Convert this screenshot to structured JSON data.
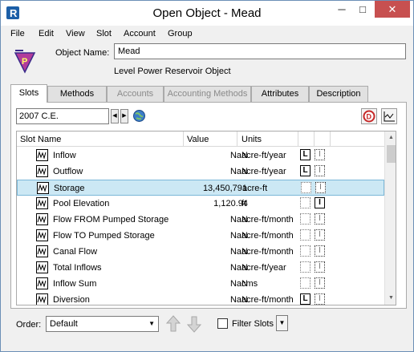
{
  "window": {
    "title": "Open Object - Mead"
  },
  "menu": [
    "File",
    "Edit",
    "View",
    "Slot",
    "Account",
    "Group"
  ],
  "object": {
    "name_label": "Object Name:",
    "name_value": "Mead",
    "type": "Level Power Reservoir Object",
    "icon_letter": "P"
  },
  "tabs": [
    {
      "label": "Slots",
      "active": true,
      "disabled": false
    },
    {
      "label": "Methods",
      "active": false,
      "disabled": false
    },
    {
      "label": "Accounts",
      "active": false,
      "disabled": true
    },
    {
      "label": "Accounting Methods",
      "active": false,
      "disabled": true
    },
    {
      "label": "Attributes",
      "active": false,
      "disabled": false
    },
    {
      "label": "Description",
      "active": false,
      "disabled": false
    }
  ],
  "date": {
    "value": "2007 C.E."
  },
  "table": {
    "headers": {
      "name": "Slot Name",
      "value": "Value",
      "units": "Units"
    },
    "rows": [
      {
        "name": "Inflow",
        "value": "NaN",
        "units": "acre-ft/year",
        "flag1": "L",
        "flag2": "I",
        "selected": false
      },
      {
        "name": "Outflow",
        "value": "NaN",
        "units": "acre-ft/year",
        "flag1": "L",
        "flag2": "I",
        "selected": false
      },
      {
        "name": "Storage",
        "value": "13,450,791",
        "units": "acre-ft",
        "flag1": "",
        "flag2": "I",
        "selected": true
      },
      {
        "name": "Pool Elevation",
        "value": "1,120.94",
        "units": "ft",
        "flag1": "",
        "flag2": "I",
        "selected": false
      },
      {
        "name": "Flow FROM Pumped Storage",
        "value": "NaN",
        "units": "acre-ft/month",
        "flag1": "",
        "flag2": "I",
        "selected": false
      },
      {
        "name": "Flow TO Pumped Storage",
        "value": "NaN",
        "units": "acre-ft/month",
        "flag1": "",
        "flag2": "I",
        "selected": false
      },
      {
        "name": "Canal Flow",
        "value": "NaN",
        "units": "acre-ft/month",
        "flag1": "",
        "flag2": "I",
        "selected": false
      },
      {
        "name": "Total Inflows",
        "value": "NaN",
        "units": "acre-ft/year",
        "flag1": "",
        "flag2": "I",
        "selected": false
      },
      {
        "name": "Inflow Sum",
        "value": "NaN",
        "units": "cms",
        "flag1": "",
        "flag2": "I",
        "selected": false
      },
      {
        "name": "Diversion",
        "value": "NaN",
        "units": "acre-ft/month",
        "flag1": "L",
        "flag2": "I",
        "selected": false
      }
    ]
  },
  "bottom": {
    "order_label": "Order:",
    "order_value": "Default",
    "filter_label": "Filter Slots"
  },
  "colors": {
    "selection": "#cce8f4",
    "close": "#c75050",
    "app_icon": "#1c5fa8"
  }
}
